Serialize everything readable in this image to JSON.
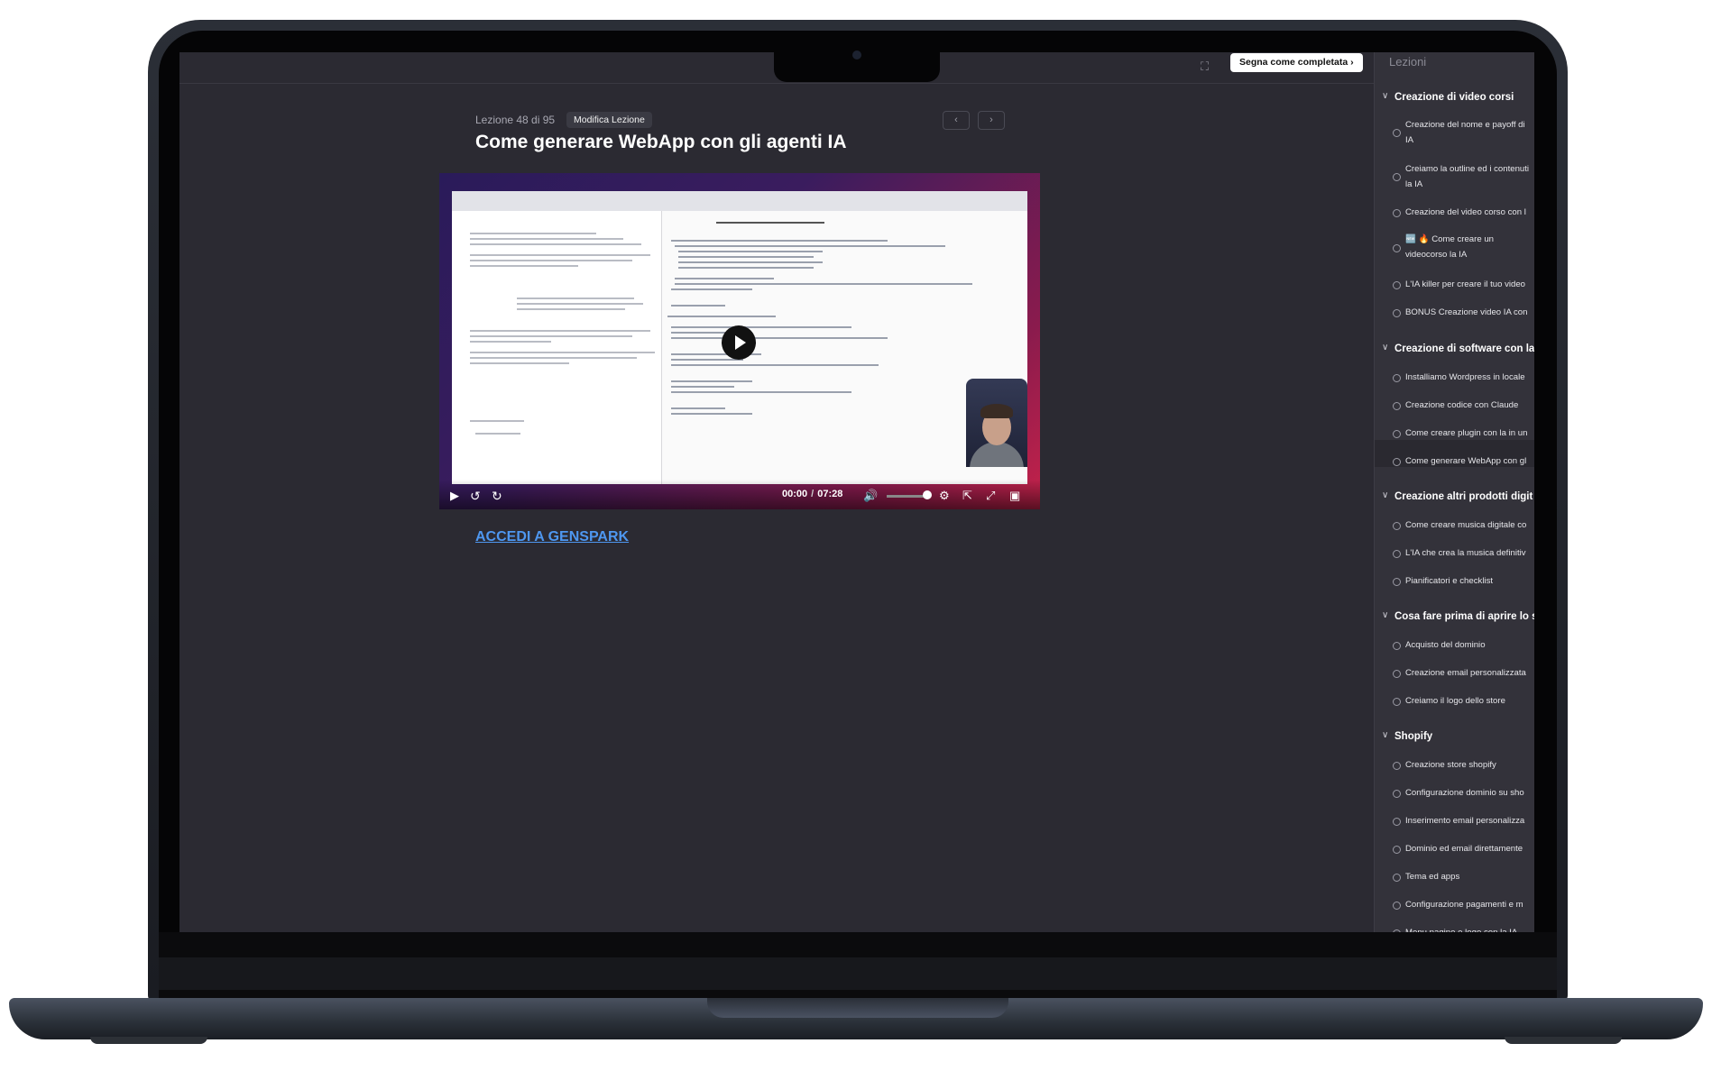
{
  "header": {
    "complete_label": "Segna come completata ›",
    "fullscreen_icon": "expand-icon"
  },
  "lesson": {
    "counter": "Lezione 48 di 95",
    "edit_label": "Modifica Lezione",
    "title": "Come generare WebApp con gli agenti IA",
    "prev_icon": "‹",
    "next_icon": "›"
  },
  "video": {
    "current_time": "00:00",
    "separator": "/",
    "duration": "07:28",
    "progress": 0
  },
  "link": {
    "label": "ACCEDI A GENSPARK"
  },
  "sidebar": {
    "title": "Lezioni",
    "sections": [
      {
        "title": "Creazione di video corsi",
        "items": [
          "Creazione del nome e payoff di IA",
          "Creiamo la outline ed i contenuti la IA",
          "Creazione del video corso con l",
          "🆕 🔥 Come creare un videocorso la IA",
          "L'IA killer per creare il tuo video",
          "BONUS Creazione video IA con"
        ]
      },
      {
        "title": "Creazione di software con la",
        "items": [
          "Installiamo Wordpress in locale",
          "Creazione codice con Claude",
          "Come creare plugin con la in un",
          "Come generare WebApp con gl"
        ]
      },
      {
        "title": "Creazione altri prodotti digit",
        "items": [
          "Come creare musica digitale co",
          "L'IA che crea la musica definitiv",
          "Pianificatori e checklist"
        ]
      },
      {
        "title": "Cosa fare prima di aprire lo s",
        "items": [
          "Acquisto del dominio",
          "Creazione email personalizzata",
          "Creiamo il logo dello store"
        ]
      },
      {
        "title": "Shopify",
        "items": [
          "Creazione store shopify",
          "Configurazione dominio su sho",
          "Inserimento email personalizza",
          "Dominio ed email direttamente",
          "Tema ed apps",
          "Configurazione pagamenti e m",
          "Menu pagine e logo con la IA"
        ]
      }
    ]
  }
}
